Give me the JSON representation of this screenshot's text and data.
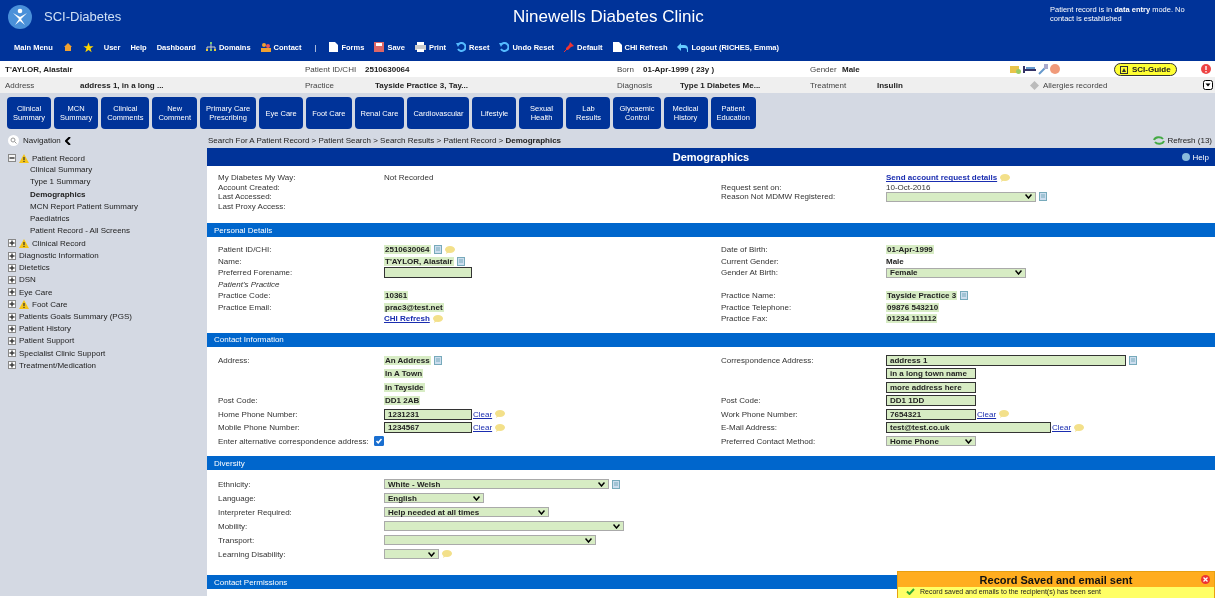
{
  "header": {
    "logo_text": "SCI-Diabetes",
    "title": "Ninewells Diabetes Clinic",
    "notice": "Patient record is in **data entry** mode. No contact is established"
  },
  "menu": [
    {
      "kind": "text",
      "label": "Main Menu"
    },
    {
      "kind": "home"
    },
    {
      "kind": "star"
    },
    {
      "kind": "text",
      "label": "User"
    },
    {
      "kind": "text",
      "label": "Help"
    },
    {
      "kind": "text",
      "label": "Dashboard"
    },
    {
      "kind": "domains",
      "label": "Domains"
    },
    {
      "kind": "contact",
      "label": "Contact"
    },
    {
      "kind": "separator",
      "label": "|"
    },
    {
      "kind": "forms",
      "label": "Forms"
    },
    {
      "kind": "save",
      "label": "Save"
    },
    {
      "kind": "print",
      "label": "Print"
    },
    {
      "kind": "reset",
      "label": "Reset"
    },
    {
      "kind": "undo",
      "label": "Undo Reset"
    },
    {
      "kind": "default",
      "label": "Default"
    },
    {
      "kind": "chi",
      "label": "CHI Refresh"
    },
    {
      "kind": "logout",
      "label": "Logout (RICHES, Emma)"
    }
  ],
  "patient_bar": {
    "rows": [
      [
        {
          "value": "T'AYLOR, Alastair"
        },
        {
          "label": "Patient ID/CHI",
          "value": "2510630064"
        },
        {
          "label": "Born",
          "value": "01-Apr-1999 ( 23y )"
        },
        {
          "label": "Gender",
          "value": "Male"
        }
      ],
      [
        {
          "label": "Address",
          "value": "address 1, in a long ..."
        },
        {
          "label": "Practice",
          "value": "Tayside Practice 3, Tay..."
        },
        {
          "label": "Diagnosis",
          "value": "Type 1 Diabetes Me..."
        },
        {
          "label": "Treatment",
          "value": "Insulin"
        }
      ]
    ],
    "guide": "SCI-Guide",
    "allergies": "Allergies recorded"
  },
  "tabs": [
    {
      "label": "Clinical\nSummary"
    },
    {
      "label": "MCN\nSummary"
    },
    {
      "label": "Clinical\nComments"
    },
    {
      "label": "New\nComment"
    },
    {
      "label": "Primary Care\nPrescribing"
    },
    {
      "label": "Eye Care"
    },
    {
      "label": "Foot Care"
    },
    {
      "label": "Renal Care"
    },
    {
      "label": "Cardiovascular"
    },
    {
      "label": "Lifestyle"
    },
    {
      "label": "Sexual\nHealth"
    },
    {
      "label": "Lab\nResults"
    },
    {
      "label": "Glycaemic\nControl"
    },
    {
      "label": "Medical\nHistory"
    },
    {
      "label": "Patient\nEducation"
    }
  ],
  "navigation": {
    "label": "Navigation",
    "breadcrumb": "Search For A Patient Record > Patient Search > Search Results > Patient Record > **Demographics**",
    "refresh": "Refresh (13)"
  },
  "sidebar": {
    "items": [
      {
        "label": "Patient Record",
        "expanded": true,
        "warning": true,
        "children": [
          {
            "label": "Clinical Summary",
            "selected": false
          },
          {
            "label": "Type 1 Summary",
            "selected": false
          },
          {
            "label": "Demographics",
            "selected": true
          },
          {
            "label": "MCN Report Patient Summary",
            "selected": false
          },
          {
            "label": "Paediatrics",
            "selected": false
          },
          {
            "label": "Patient Record - All Screens",
            "selected": false
          }
        ]
      },
      {
        "label": "Clinical Record",
        "expanded": false,
        "warning": true
      },
      {
        "label": "Diagnostic Information",
        "expanded": false,
        "warning": false
      },
      {
        "label": "Dietetics",
        "expanded": false,
        "warning": false
      },
      {
        "label": "DSN",
        "expanded": false,
        "warning": false
      },
      {
        "label": "Eye Care",
        "expanded": false,
        "warning": false
      },
      {
        "label": "Foot Care",
        "expanded": false,
        "warning": true
      },
      {
        "label": "Patients Goals Summary (PGS)",
        "expanded": false,
        "warning": false
      },
      {
        "label": "Patient History",
        "expanded": false,
        "warning": false
      },
      {
        "label": "Patient Support",
        "expanded": false,
        "warning": false
      },
      {
        "label": "Specialist Clinic Support",
        "expanded": false,
        "warning": false
      },
      {
        "label": "Treatment/Medication",
        "expanded": false,
        "warning": false
      }
    ]
  },
  "page": {
    "title": "Demographics",
    "help": "Help"
  },
  "sections": [
    {
      "rows": [
        {
          "left": {
            "label": "My Diabetes My Way:",
            "kind": "text",
            "value": "Not Recorded"
          },
          "right": {
            "kind": "link",
            "value": "Send account request details",
            "comment": true
          }
        },
        {
          "left": {
            "label": "Account Created:",
            "kind": "text"
          },
          "right": {
            "label": "Request sent on:",
            "kind": "text",
            "value": "10-Oct-2016"
          }
        },
        {
          "left": {
            "label": "Last Accessed:",
            "kind": "text"
          },
          "right": {
            "label": "Reason Not MDMW Registered:",
            "kind": "select",
            "copy": true
          }
        },
        {
          "left": {
            "label": "Last Proxy Access:",
            "kind": "text"
          }
        }
      ]
    },
    {
      "title": "Personal Details",
      "rows": [
        {
          "left": {
            "label": "Patient ID/CHI:",
            "kind": "highlight",
            "value": "2510630064",
            "copy": true,
            "comment": true
          },
          "right": {
            "label": "Date of Birth:",
            "kind": "highlight",
            "value": "01-Apr-1999"
          }
        },
        {
          "left": {
            "label": "Name:",
            "kind": "highlight",
            "value": "T'AYLOR, Alastair",
            "copy": true
          },
          "right": {
            "label": "Current Gender:",
            "kind": "bold",
            "value": "Male"
          }
        },
        {
          "left": {
            "label": "Preferred Forename:",
            "kind": "input"
          },
          "right": {
            "label": "Gender At Birth:",
            "kind": "select",
            "value": "Female"
          }
        },
        {
          "left": {
            "label": "Patient's Practice",
            "kind": "subheading"
          }
        },
        {
          "left": {
            "label": "Practice Code:",
            "kind": "highlight",
            "value": "10361"
          },
          "right": {
            "label": "Practice Name:",
            "kind": "highlight",
            "value": "Tayside Practice 3",
            "copy": true
          }
        },
        {
          "left": {
            "label": "Practice Email:",
            "kind": "highlight",
            "value": "prac3@test.net"
          },
          "right": {
            "label": "Practice Telephone:",
            "kind": "highlight",
            "value": "09876 543210"
          }
        },
        {
          "left": {
            "kind": "link",
            "value": "CHI Refresh",
            "comment": true
          },
          "right": {
            "label": "Practice Fax:",
            "kind": "highlight",
            "value": "01234 111112"
          }
        }
      ]
    },
    {
      "title": "Contact Information",
      "rows": [
        {
          "left": {
            "label": "Address:",
            "kind": "highlight",
            "value": "An Address",
            "copy": true
          },
          "right": {
            "label": "Correspondence Address:",
            "kind": "input",
            "value": "address 1",
            "copy": true
          }
        },
        {
          "left": {
            "kind": "highlight",
            "value": "In A Town"
          },
          "right": {
            "kind": "input",
            "value": "in a long town name"
          }
        },
        {
          "left": {
            "kind": "highlight",
            "value": "In Tayside"
          },
          "right": {
            "kind": "input",
            "value": "more address here"
          }
        },
        {
          "left": {
            "label": "Post Code:",
            "kind": "highlight",
            "value": "DD1 2AB"
          },
          "right": {
            "label": "Post Code:",
            "kind": "input",
            "value": "DD1 1DD"
          }
        },
        {
          "left": {
            "label": "Home Phone Number:",
            "kind": "input",
            "value": "1231231",
            "clear": "Clear",
            "comment": true
          },
          "right": {
            "label": "Work Phone Number:",
            "kind": "input",
            "value": "7654321",
            "clear": "Clear",
            "comment": true
          }
        },
        {
          "left": {
            "label": "Mobile Phone Number:",
            "kind": "input",
            "value": "1234567",
            "clear": "Clear",
            "comment": true
          },
          "right": {
            "label": "E-Mail Address:",
            "kind": "input",
            "value": "test@test.co.uk",
            "clear": "Clear",
            "comment": true
          }
        },
        {
          "left": {
            "label": "Enter alternative correspondence address:",
            "kind": "checkbox",
            "checked": true
          },
          "right": {
            "label": "Preferred Contact Method:",
            "kind": "select",
            "value": "Home Phone"
          }
        }
      ]
    },
    {
      "title": "Diversity",
      "rows": [
        {
          "left": {
            "label": "Ethnicity:",
            "kind": "select",
            "value": "White - Welsh",
            "copy": true
          }
        },
        {
          "left": {
            "label": "Language:",
            "kind": "select",
            "value": "English"
          }
        },
        {
          "left": {
            "label": "Interpreter Required:",
            "kind": "select",
            "value": "Help needed at all times"
          }
        },
        {
          "left": {
            "label": "Mobility:",
            "kind": "select"
          }
        },
        {
          "left": {
            "label": "Transport:",
            "kind": "select"
          }
        },
        {
          "left": {
            "label": "Learning Disability:",
            "kind": "select",
            "comment": true
          }
        }
      ]
    },
    {
      "title": "Contact Permissions"
    }
  ],
  "toast": {
    "title": "Record Saved and email sent",
    "message": "Record saved and emails to the recipient(s) has been sent"
  }
}
